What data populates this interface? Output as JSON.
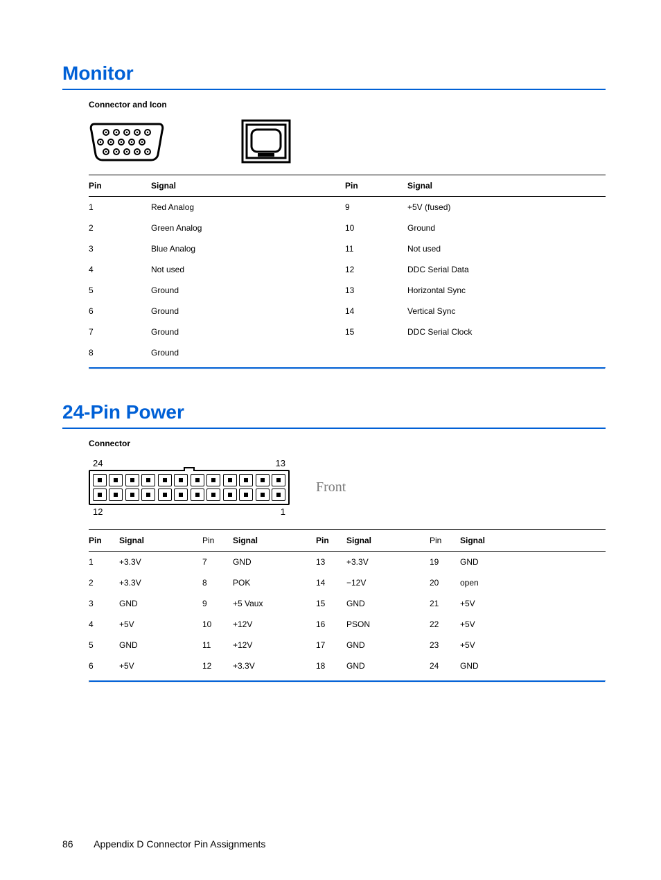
{
  "sections": {
    "monitor": {
      "title": "Monitor",
      "subhead": "Connector and Icon",
      "table": {
        "headers": {
          "pin": "Pin",
          "signal": "Signal"
        },
        "rows_left": [
          {
            "pin": "1",
            "signal": "Red Analog"
          },
          {
            "pin": "2",
            "signal": "Green Analog"
          },
          {
            "pin": "3",
            "signal": "Blue Analog"
          },
          {
            "pin": "4",
            "signal": "Not used"
          },
          {
            "pin": "5",
            "signal": "Ground"
          },
          {
            "pin": "6",
            "signal": "Ground"
          },
          {
            "pin": "7",
            "signal": "Ground"
          },
          {
            "pin": "8",
            "signal": "Ground"
          }
        ],
        "rows_right": [
          {
            "pin": "9",
            "signal": "+5V (fused)"
          },
          {
            "pin": "10",
            "signal": "Ground"
          },
          {
            "pin": "11",
            "signal": "Not used"
          },
          {
            "pin": "12",
            "signal": "DDC Serial Data"
          },
          {
            "pin": "13",
            "signal": "Horizontal Sync"
          },
          {
            "pin": "14",
            "signal": "Vertical Sync"
          },
          {
            "pin": "15",
            "signal": "DDC Serial Clock"
          }
        ]
      }
    },
    "power": {
      "title": "24-Pin Power",
      "subhead": "Connector",
      "fig_labels": {
        "tl": "24",
        "tr": "13",
        "bl": "12",
        "br": "1"
      },
      "front_label": "Front",
      "table": {
        "headers": {
          "pin": "Pin",
          "signal": "Signal"
        },
        "cols": [
          [
            {
              "pin": "1",
              "signal": "+3.3V"
            },
            {
              "pin": "2",
              "signal": "+3.3V"
            },
            {
              "pin": "3",
              "signal": "GND"
            },
            {
              "pin": "4",
              "signal": "+5V"
            },
            {
              "pin": "5",
              "signal": "GND"
            },
            {
              "pin": "6",
              "signal": "+5V"
            }
          ],
          [
            {
              "pin": "7",
              "signal": "GND"
            },
            {
              "pin": "8",
              "signal": "POK"
            },
            {
              "pin": "9",
              "signal": "+5 Vaux"
            },
            {
              "pin": "10",
              "signal": "+12V"
            },
            {
              "pin": "11",
              "signal": "+12V"
            },
            {
              "pin": "12",
              "signal": "+3.3V"
            }
          ],
          [
            {
              "pin": "13",
              "signal": "+3.3V"
            },
            {
              "pin": "14",
              "signal": "−12V"
            },
            {
              "pin": "15",
              "signal": "GND"
            },
            {
              "pin": "16",
              "signal": "PSON"
            },
            {
              "pin": "17",
              "signal": "GND"
            },
            {
              "pin": "18",
              "signal": "GND"
            }
          ],
          [
            {
              "pin": "19",
              "signal": "GND"
            },
            {
              "pin": "20",
              "signal": "open"
            },
            {
              "pin": "21",
              "signal": "+5V"
            },
            {
              "pin": "22",
              "signal": "+5V"
            },
            {
              "pin": "23",
              "signal": "+5V"
            },
            {
              "pin": "24",
              "signal": "GND"
            }
          ]
        ]
      }
    }
  },
  "footer": {
    "page": "86",
    "text": "Appendix D   Connector Pin Assignments"
  }
}
